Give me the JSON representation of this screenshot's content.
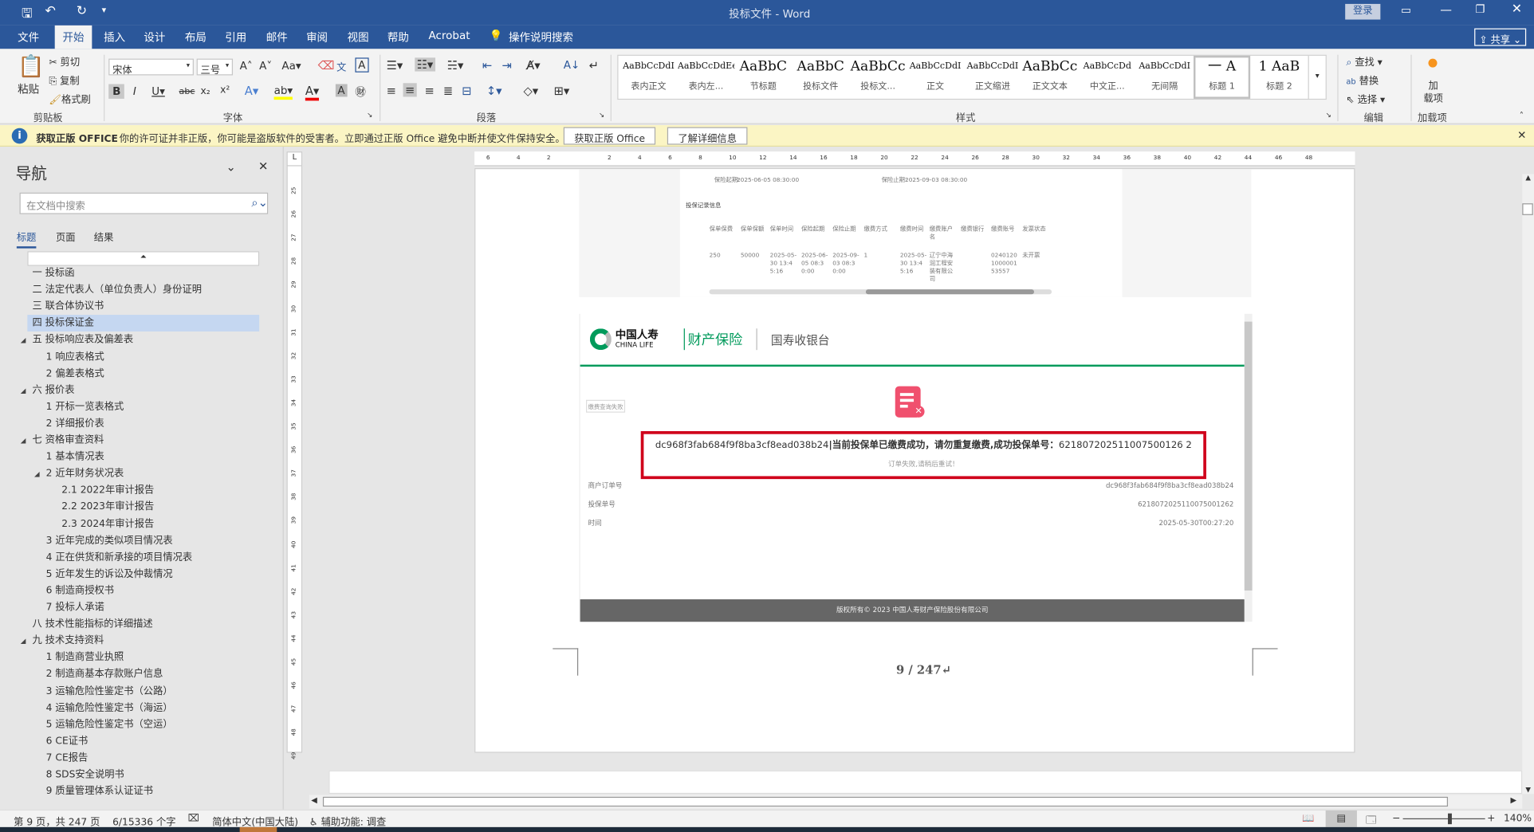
{
  "app": {
    "title": "投标文件 - Word",
    "login": "登录",
    "share": "共享"
  },
  "quick_access": {
    "save": "save-icon",
    "undo": "undo-icon",
    "redo": "redo-icon",
    "customize": "▾"
  },
  "tabs": [
    "文件",
    "开始",
    "插入",
    "设计",
    "布局",
    "引用",
    "邮件",
    "审阅",
    "视图",
    "帮助",
    "Acrobat"
  ],
  "tell_me": "操作说明搜索",
  "ribbon": {
    "clipboard": {
      "label": "剪贴板",
      "paste": "粘贴",
      "cut": "剪切",
      "copy": "复制",
      "format_painter": "格式刷"
    },
    "font": {
      "label": "字体",
      "font_name": "宋体",
      "font_size": "三号"
    },
    "paragraph": {
      "label": "段落"
    },
    "styles": {
      "label": "样式",
      "items": [
        {
          "sample": "AaBbCcDdI",
          "name": "表内正文"
        },
        {
          "sample": "AaBbCcDdEe",
          "name": "表内左..."
        },
        {
          "sample": "AaBbC",
          "name": "节标题"
        },
        {
          "sample": "AaBbC",
          "name": "投标文件"
        },
        {
          "sample": "AaBbCc",
          "name": "投标文..."
        },
        {
          "sample": "AaBbCcDdI",
          "name": "正文"
        },
        {
          "sample": "AaBbCcDdI",
          "name": "正文缩进"
        },
        {
          "sample": "AaBbCc",
          "name": "正文文本"
        },
        {
          "sample": "AaBbCcDd",
          "name": "中文正..."
        },
        {
          "sample": "AaBbCcDdI",
          "name": "无间隔"
        },
        {
          "sample": "一  A",
          "name": "标题 1"
        },
        {
          "sample": "1  AaB",
          "name": "标题 2"
        }
      ]
    },
    "editing": {
      "label": "编辑",
      "find": "查找",
      "replace": "替换",
      "select": "选择"
    },
    "addins": {
      "label": "加载项",
      "button": "加\n载项"
    }
  },
  "infobar": {
    "title": "获取正版 OFFICE",
    "message": "你的许可证并非正版，你可能是盗版软件的受害者。立即通过正版 Office 避免中断并使文件保持安全。",
    "btn1": "获取正版 Office",
    "btn2": "了解详细信息"
  },
  "nav": {
    "title": "导航",
    "search_placeholder": "在文档中搜索",
    "tabs": [
      "标题",
      "页面",
      "结果"
    ],
    "active_tab": 0,
    "items": [
      {
        "text": "一 投标函",
        "level": 0
      },
      {
        "text": "二 法定代表人（单位负责人）身份证明",
        "level": 0
      },
      {
        "text": "三 联合体协议书",
        "level": 0
      },
      {
        "text": "四 投标保证金",
        "level": 0,
        "selected": true
      },
      {
        "text": "五 投标响应表及偏差表",
        "level": 0,
        "expanded": true
      },
      {
        "text": "1 响应表格式",
        "level": 1
      },
      {
        "text": "2 偏差表格式",
        "level": 1
      },
      {
        "text": "六 报价表",
        "level": 0,
        "expanded": true
      },
      {
        "text": "1 开标一览表格式",
        "level": 1
      },
      {
        "text": "2 详细报价表",
        "level": 1
      },
      {
        "text": "七 资格审查资料",
        "level": 0,
        "expanded": true
      },
      {
        "text": "1 基本情况表",
        "level": 1
      },
      {
        "text": "2 近年财务状况表",
        "level": 1,
        "expanded": true
      },
      {
        "text": "2.1 2022年审计报告",
        "level": 2
      },
      {
        "text": "2.2 2023年审计报告",
        "level": 2
      },
      {
        "text": "2.3 2024年审计报告",
        "level": 2
      },
      {
        "text": "3 近年完成的类似项目情况表",
        "level": 1
      },
      {
        "text": "4 正在供货和新承接的项目情况表",
        "level": 1
      },
      {
        "text": "5 近年发生的诉讼及仲裁情况",
        "level": 1
      },
      {
        "text": "6 制造商授权书",
        "level": 1
      },
      {
        "text": "7 投标人承诺",
        "level": 1
      },
      {
        "text": "八 技术性能指标的详细描述",
        "level": 0
      },
      {
        "text": "九 技术支持资料",
        "level": 0,
        "expanded": true
      },
      {
        "text": "1 制造商营业执照",
        "level": 1
      },
      {
        "text": "2 制造商基本存款账户信息",
        "level": 1
      },
      {
        "text": "3 运输危险性鉴定书（公路）",
        "level": 1
      },
      {
        "text": "4 运输危险性鉴定书（海运）",
        "level": 1
      },
      {
        "text": "5 运输危险性鉴定书（空运）",
        "level": 1
      },
      {
        "text": "6 CE证书",
        "level": 1
      },
      {
        "text": "7 CE报告",
        "level": 1
      },
      {
        "text": "8 SDS安全说明书",
        "level": 1
      },
      {
        "text": "9 质量管理体系认证证书",
        "level": 1
      }
    ]
  },
  "doc": {
    "shot1": {
      "start_label": "保险起期:",
      "start": "2025-06-05 08:30:00",
      "end_label": "保险止期:",
      "end": "2025-09-03 08:30:00",
      "section": "投保记录信息",
      "headers": [
        "保单保费",
        "保单保额",
        "保单时间",
        "保险起期",
        "保险止期",
        "缴费方式",
        "缴费时间",
        "缴费账户名",
        "缴费银行",
        "缴费账号",
        "发票状态"
      ],
      "row": [
        "250",
        "50000",
        "2025-05-30 13:45:16",
        "2025-06-05 08:30:00",
        "2025-09-03 08:30:00",
        "1",
        "2025-05-30 13:45:16",
        "辽宁中海润工程安装有限公司",
        "",
        "0240120100000153557",
        "未开票"
      ]
    },
    "shot2": {
      "logo_cn": "中国人寿",
      "logo_en": "CHINA LIFE",
      "brand": "财产保险",
      "cashier": "国寿收银台",
      "tag": "缴费查询失败",
      "error_id": "dc968f3fab684f9f8ba3cf8ead038b24",
      "error_msg": "|当前投保单已缴费成功，请勿重复缴费,成功投保单号：",
      "error_no": "621807202511007500126 2",
      "sub": "订单失败,请稍后重试！",
      "details": [
        {
          "k": "商户订单号",
          "v": "dc968f3fab684f9f8ba3cf8ead038b24"
        },
        {
          "k": "投保单号",
          "v": "6218072025110075001262"
        },
        {
          "k": "时间",
          "v": "2025-05-30T00:27:20"
        }
      ],
      "footer": "版权所有© 2023 中国人寿财产保险股份有限公司",
      "brand_color": "#009a5b",
      "alert_color": "#d0021b"
    },
    "page_number": "9 / 247↵"
  },
  "status": {
    "page": "第 9 页，共 247 页",
    "words": "6/15336 个字",
    "language": "简体中文(中国大陆)",
    "accessibility": "辅助功能: 调查",
    "zoom": "140%",
    "zoom_level": 140
  }
}
